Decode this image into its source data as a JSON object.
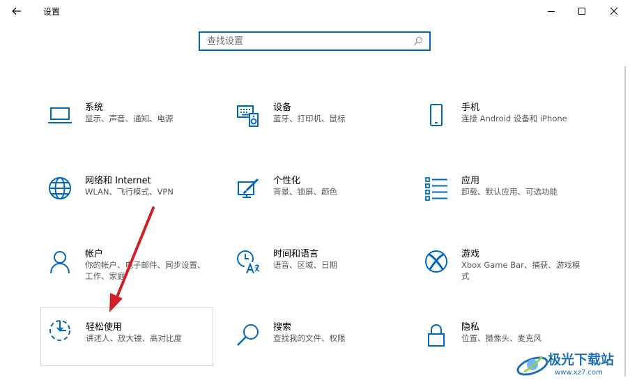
{
  "window": {
    "title": "设置",
    "controls": {
      "minimize": "minimize-icon",
      "maximize": "maximize-icon",
      "close": "close-icon"
    }
  },
  "search": {
    "placeholder": "查找设置",
    "value": ""
  },
  "tiles": [
    {
      "name": "系统",
      "desc": "显示、声音、通知、电源",
      "icon": "laptop-icon"
    },
    {
      "name": "设备",
      "desc": "蓝牙、打印机、鼠标",
      "icon": "keyboard-speaker-icon"
    },
    {
      "name": "手机",
      "desc": "连接 Android 设备和 iPhone",
      "icon": "phone-icon"
    },
    {
      "name": "网络和 Internet",
      "desc": "WLAN、飞行模式、VPN",
      "icon": "globe-icon"
    },
    {
      "name": "个性化",
      "desc": "背景、锁屏、颜色",
      "icon": "paint-brush-icon"
    },
    {
      "name": "应用",
      "desc": "卸载、默认应用、可选功能",
      "icon": "apps-list-icon"
    },
    {
      "name": "帐户",
      "desc": "你的帐户、电子邮件、同步设置、工作、家庭",
      "icon": "person-icon"
    },
    {
      "name": "时间和语言",
      "desc": "语音、区域、日期",
      "icon": "time-language-icon"
    },
    {
      "name": "游戏",
      "desc": "Xbox Game Bar、捕获、游戏模式",
      "icon": "xbox-icon"
    },
    {
      "name": "轻松使用",
      "desc": "讲述人、放大镜、高对比度",
      "icon": "ease-of-access-icon"
    },
    {
      "name": "搜索",
      "desc": "查找我的文件、权限",
      "icon": "magnifier-icon"
    },
    {
      "name": "隐私",
      "desc": "位置、摄像头、麦克风",
      "icon": "lock-icon"
    }
  ],
  "watermark": {
    "title": "极光下载站",
    "url": "www.xz7.com"
  },
  "colors": {
    "accent": "#0067c0",
    "annotation": "#d11f24"
  }
}
